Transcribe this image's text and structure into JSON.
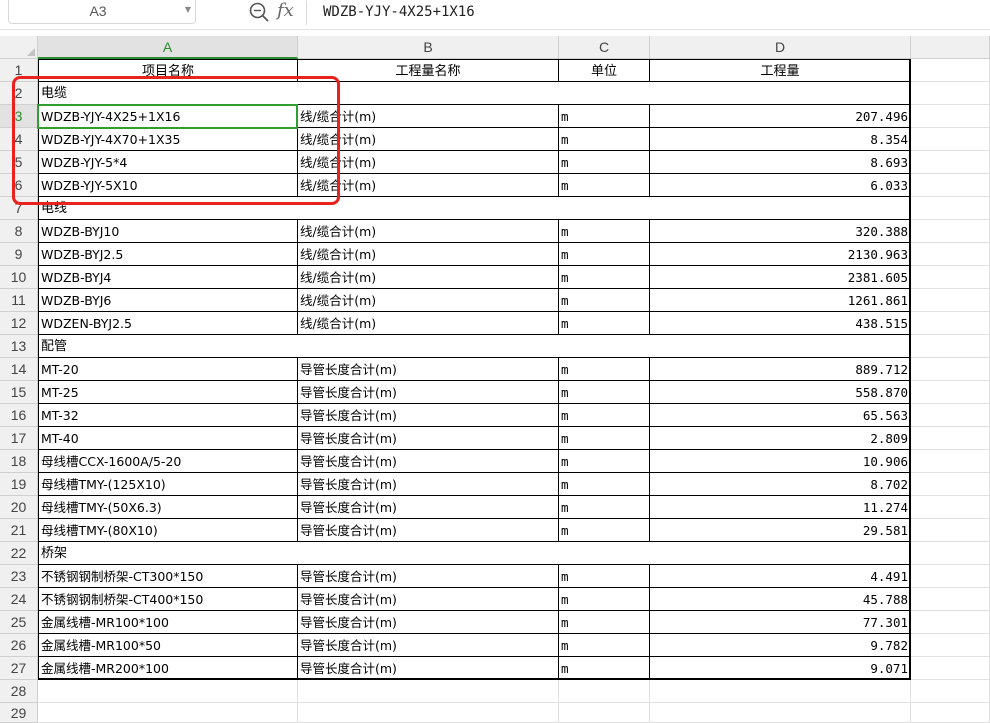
{
  "name_box": "A3",
  "formula_value": "WDZB-YJY-4X25+1X16",
  "columns": [
    "A",
    "B",
    "C",
    "D"
  ],
  "active_col": "A",
  "active_row": "3",
  "header_row": [
    "项目名称",
    "工程量名称",
    "单位",
    "工程量"
  ],
  "rows": [
    {
      "num": "2",
      "section": "电缆"
    },
    {
      "num": "3",
      "a": "WDZB-YJY-4X25+1X16",
      "b": "线/缆合计(m)",
      "c": "m",
      "d": "207.496"
    },
    {
      "num": "4",
      "a": "WDZB-YJY-4X70+1X35",
      "b": "线/缆合计(m)",
      "c": "m",
      "d": "8.354"
    },
    {
      "num": "5",
      "a": "WDZB-YJY-5*4",
      "b": "线/缆合计(m)",
      "c": "m",
      "d": "8.693"
    },
    {
      "num": "6",
      "a": "WDZB-YJY-5X10",
      "b": "线/缆合计(m)",
      "c": "m",
      "d": "6.033"
    },
    {
      "num": "7",
      "section": "电线"
    },
    {
      "num": "8",
      "a": "WDZB-BYJ10",
      "b": "线/缆合计(m)",
      "c": "m",
      "d": "320.388"
    },
    {
      "num": "9",
      "a": "WDZB-BYJ2.5",
      "b": "线/缆合计(m)",
      "c": "m",
      "d": "2130.963"
    },
    {
      "num": "10",
      "a": "WDZB-BYJ4",
      "b": "线/缆合计(m)",
      "c": "m",
      "d": "2381.605"
    },
    {
      "num": "11",
      "a": "WDZB-BYJ6",
      "b": "线/缆合计(m)",
      "c": "m",
      "d": "1261.861"
    },
    {
      "num": "12",
      "a": "WDZEN-BYJ2.5",
      "b": "线/缆合计(m)",
      "c": "m",
      "d": "438.515"
    },
    {
      "num": "13",
      "section": "配管"
    },
    {
      "num": "14",
      "a": "MT-20",
      "b": "导管长度合计(m)",
      "c": "m",
      "d": "889.712"
    },
    {
      "num": "15",
      "a": "MT-25",
      "b": "导管长度合计(m)",
      "c": "m",
      "d": "558.870"
    },
    {
      "num": "16",
      "a": "MT-32",
      "b": "导管长度合计(m)",
      "c": "m",
      "d": "65.563"
    },
    {
      "num": "17",
      "a": "MT-40",
      "b": "导管长度合计(m)",
      "c": "m",
      "d": "2.809"
    },
    {
      "num": "18",
      "a": "母线槽CCX-1600A/5-20",
      "b": "导管长度合计(m)",
      "c": "m",
      "d": "10.906"
    },
    {
      "num": "19",
      "a": "母线槽TMY-(125X10)",
      "b": "导管长度合计(m)",
      "c": "m",
      "d": "8.702"
    },
    {
      "num": "20",
      "a": "母线槽TMY-(50X6.3)",
      "b": "导管长度合计(m)",
      "c": "m",
      "d": "11.274"
    },
    {
      "num": "21",
      "a": "母线槽TMY-(80X10)",
      "b": "导管长度合计(m)",
      "c": "m",
      "d": "29.581"
    },
    {
      "num": "22",
      "section": "桥架"
    },
    {
      "num": "23",
      "a": "不锈钢钢制桥架-CT300*150",
      "b": "导管长度合计(m)",
      "c": "m",
      "d": "4.491"
    },
    {
      "num": "24",
      "a": "不锈钢钢制桥架-CT400*150",
      "b": "导管长度合计(m)",
      "c": "m",
      "d": "45.788"
    },
    {
      "num": "25",
      "a": "金属线槽-MR100*100",
      "b": "导管长度合计(m)",
      "c": "m",
      "d": "77.301"
    },
    {
      "num": "26",
      "a": "金属线槽-MR100*50",
      "b": "导管长度合计(m)",
      "c": "m",
      "d": "9.782"
    },
    {
      "num": "27",
      "a": "金属线槽-MR200*100",
      "b": "导管长度合计(m)",
      "c": "m",
      "d": "9.071"
    }
  ],
  "empty_rows": [
    "28",
    "29"
  ],
  "colors": {
    "selection": "#2f9e2f",
    "highlight_box": "#e8231d",
    "header_bg": "#f0f0f0"
  },
  "icons": {
    "zoom": "zoom-in-icon",
    "fx": "function-icon"
  }
}
